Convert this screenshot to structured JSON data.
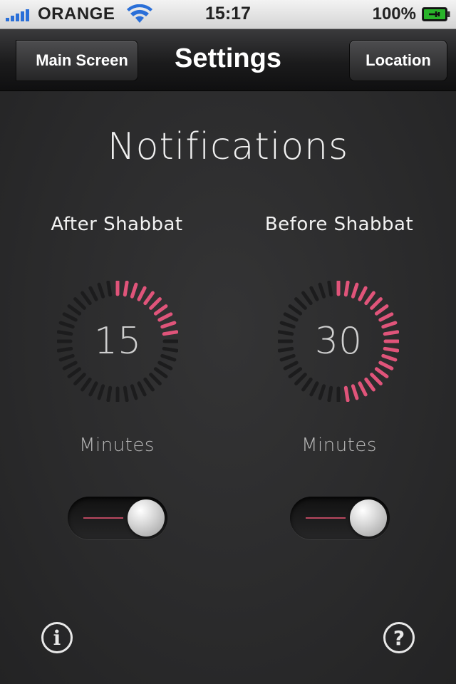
{
  "status_bar": {
    "carrier": "ORANGE",
    "time": "15:17",
    "battery": "100%",
    "icons": [
      "signal-icon",
      "wifi-icon",
      "battery-icon"
    ]
  },
  "nav": {
    "back_label": "Main Screen",
    "title": "Settings",
    "location_label": "Location"
  },
  "main": {
    "heading": "Notifications",
    "after": {
      "label": "After Shabbat",
      "value": "15",
      "units": "Minutes",
      "fraction": 0.25,
      "enabled": true
    },
    "before": {
      "label": "Before Shabbat",
      "value": "30",
      "units": "Minutes",
      "fraction": 0.5,
      "enabled": true
    }
  },
  "footer": {
    "info_glyph": "i",
    "help_glyph": "?"
  },
  "colors": {
    "accent": "#e0547a",
    "dial_inactive": "#1c1c1d",
    "background": "#2a2a2b"
  }
}
